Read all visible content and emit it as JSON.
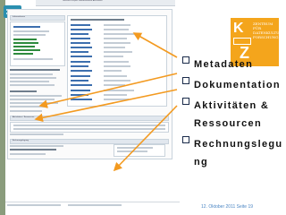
{
  "slide": {
    "bullets": [
      {
        "label": "Metadaten"
      },
      {
        "label": "Dokumentation"
      },
      {
        "label": "Aktivitäten & Ressourcen"
      },
      {
        "label": "Rechnungslegung"
      }
    ],
    "footer": "12. Oktober 2011   Seite 19"
  },
  "logo": {
    "text": "ZENTRUM FÜR DATENKULTUREN FORSCHUNG",
    "letters_top": "K",
    "letters_bottom": "Z"
  },
  "screenshot": {
    "topbar_text": "Übersicht  Projekt  Dokumentation  Aktivitäten",
    "section_titles": [
      "Informationen",
      "Aktivitäten / Ressourcen",
      "Rechnungslegung"
    ],
    "notes": [
      "Metadaten",
      "Rechnung"
    ]
  },
  "colors": {
    "arrow": "#f39a20",
    "accent_orange": "#f4a51c",
    "text_blue": "#4b86c4"
  }
}
